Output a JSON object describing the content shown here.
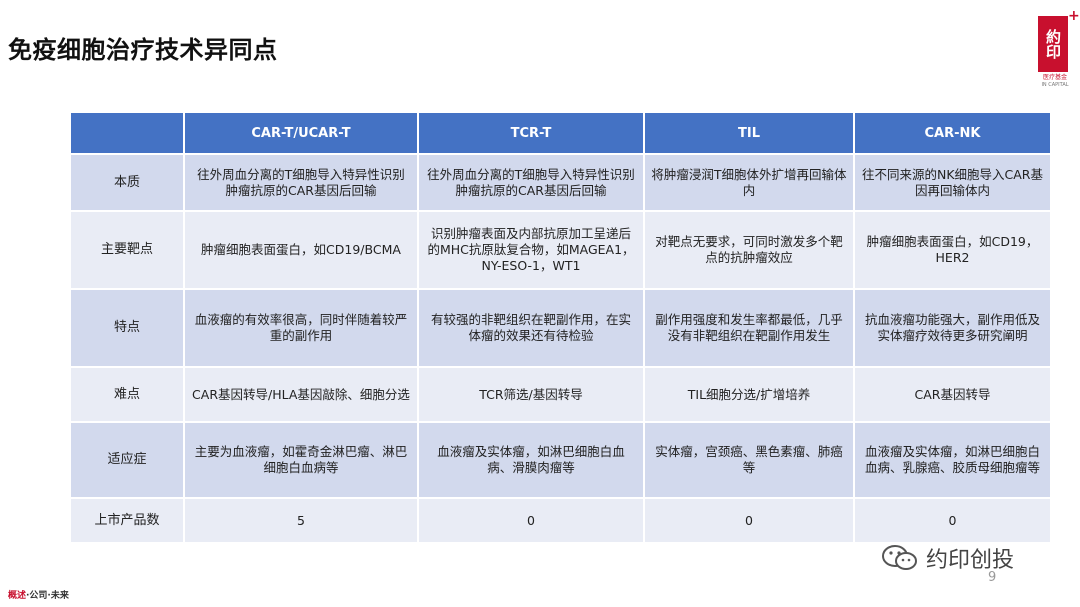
{
  "title": "免疫细胞治疗技术异同点",
  "logo": {
    "chars": "約印",
    "sub_cn": "医疗基金",
    "sub_en": "IN CAPITAL"
  },
  "table": {
    "headers": [
      "",
      "CAR-T/UCAR-T",
      "TCR-T",
      "TIL",
      "CAR-NK"
    ],
    "rows": [
      {
        "label": "本质",
        "cells": [
          "往外周血分离的T细胞导入特异性识别肿瘤抗原的CAR基因后回输",
          "往外周血分离的T细胞导入特异性识别肿瘤抗原的CAR基因后回输",
          "将肿瘤浸润T细胞体外扩增再回输体内",
          "往不同来源的NK细胞导入CAR基因再回输体内"
        ]
      },
      {
        "label": "主要靶点",
        "cells": [
          "肿瘤细胞表面蛋白，如CD19/BCMA",
          "识别肿瘤表面及内部抗原加工呈递后的MHC抗原肽复合物，如MAGEA1，NY-ESO-1，WT1",
          "对靶点无要求，可同时激发多个靶点的抗肿瘤效应",
          "肿瘤细胞表面蛋白，如CD19，HER2"
        ]
      },
      {
        "label": "特点",
        "cells": [
          "血液瘤的有效率很高，同时伴随着较严重的副作用",
          "有较强的非靶组织在靶副作用，在实体瘤的效果还有待检验",
          "副作用强度和发生率都最低，几乎没有非靶组织在靶副作用发生",
          "抗血液瘤功能强大，副作用低及实体瘤疗效待更多研究阐明"
        ]
      },
      {
        "label": "难点",
        "cells": [
          "CAR基因转导/HLA基因敲除、细胞分选",
          "TCR筛选/基因转导",
          "TIL细胞分选/扩增培养",
          "CAR基因转导"
        ]
      },
      {
        "label": "适应症",
        "cells": [
          "主要为血液瘤，如霍奇金淋巴瘤、淋巴细胞白血病等",
          "血液瘤及实体瘤，如淋巴细胞白血病、滑膜肉瘤等",
          "实体瘤，宫颈癌、黑色素瘤、肺癌等",
          "血液瘤及实体瘤，如淋巴细胞白血病、乳腺癌、胶质母细胞瘤等"
        ]
      },
      {
        "label": "上市产品数",
        "cells": [
          "5",
          "0",
          "0",
          "0"
        ]
      }
    ]
  },
  "wechat_label": "约印创投",
  "page_number": "9",
  "footer": {
    "part1": "概述",
    "part2": "·公司·未来"
  }
}
